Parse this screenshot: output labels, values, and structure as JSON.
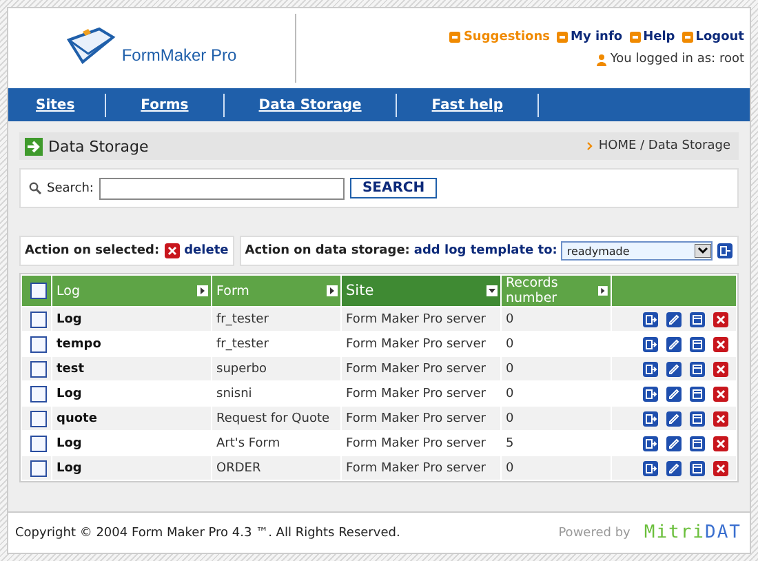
{
  "header": {
    "app_name": "FormMaker Pro",
    "links": [
      {
        "label": "Suggestions",
        "kind": "accent"
      },
      {
        "label": "My info",
        "kind": "normal"
      },
      {
        "label": "Help",
        "kind": "normal"
      },
      {
        "label": "Logout",
        "kind": "normal"
      }
    ],
    "user_text": "You logged in as: root"
  },
  "nav": [
    {
      "label": "Sites"
    },
    {
      "label": "Forms"
    },
    {
      "label": "Data Storage"
    },
    {
      "label": "Fast help"
    }
  ],
  "page_title": "Data Storage",
  "breadcrumb": "HOME / Data Storage",
  "search": {
    "label": "Search:",
    "button": "SEARCH"
  },
  "action_selected": {
    "label": "Action on selected:",
    "link": "delete"
  },
  "action_storage": {
    "label": "Action on data storage:",
    "link": "add log template to:",
    "value": "readymade"
  },
  "table": {
    "select_all": {
      "checked": false
    },
    "columns": [
      {
        "label": "Log",
        "selected": false
      },
      {
        "label": "Form",
        "selected": false
      },
      {
        "label": "Site",
        "selected": true
      },
      {
        "label": "Records number",
        "selected": false
      }
    ],
    "rows": [
      {
        "checked": false,
        "log": "Log",
        "form": "fr_tester",
        "site": "Form Maker Pro server",
        "records": "0"
      },
      {
        "checked": false,
        "log": "tempo",
        "form": "fr_tester",
        "site": "Form Maker Pro server",
        "records": "0"
      },
      {
        "checked": false,
        "log": "test",
        "form": "superbo",
        "site": "Form Maker Pro server",
        "records": "0"
      },
      {
        "checked": false,
        "log": "Log",
        "form": "snisni",
        "site": "Form Maker Pro server",
        "records": "0"
      },
      {
        "checked": false,
        "log": "quote",
        "form": "Request for Quote",
        "site": "Form Maker Pro server",
        "records": "0"
      },
      {
        "checked": false,
        "log": "Log",
        "form": "Art's Form",
        "site": "Form Maker Pro server",
        "records": "5"
      },
      {
        "checked": false,
        "log": "Log",
        "form": "ORDER",
        "site": "Form Maker Pro server",
        "records": "0"
      }
    ]
  },
  "footer": {
    "copyright": "Copyright © 2004 Form Maker Pro 4.3 ™. All Rights Reserved.",
    "powered_by": "Powered by",
    "logo_part_1": "Mitri",
    "logo_part_2": "DAT"
  }
}
